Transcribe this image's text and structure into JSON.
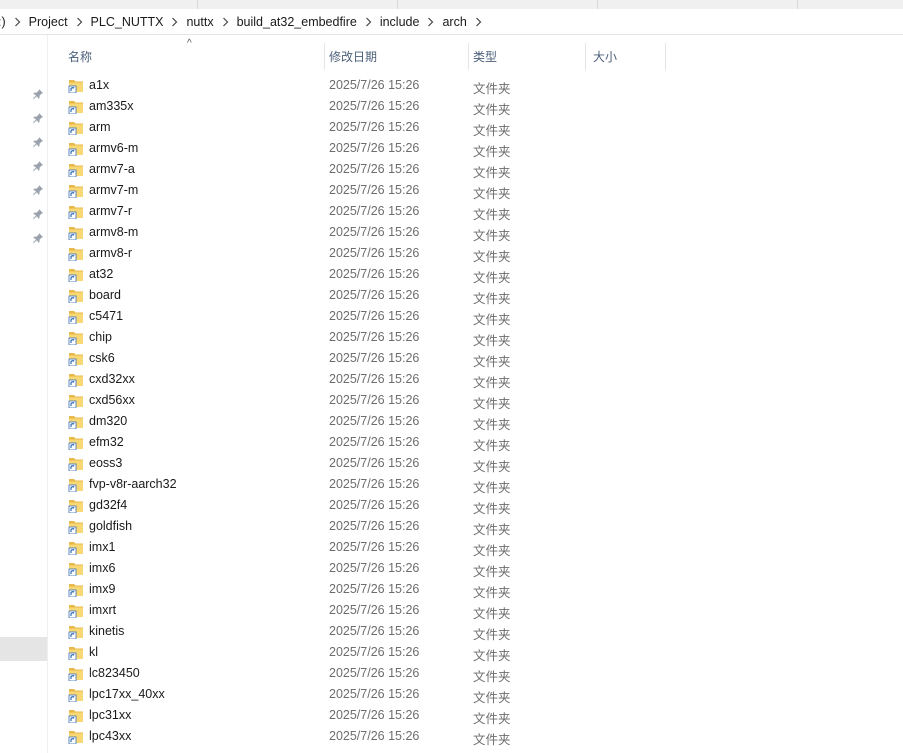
{
  "breadcrumb": {
    "items": [
      ":)",
      "Project",
      "PLC_NUTTX",
      "nuttx",
      "build_at32_embedfire",
      "include",
      "arch"
    ]
  },
  "columns": {
    "name": "名称",
    "date": "修改日期",
    "type": "类型",
    "size": "大小",
    "sort_indicator": "^"
  },
  "colors": {
    "folder_body": "#f8d775",
    "folder_back": "#e8b84a",
    "header_text": "#4c607a",
    "secondary_text": "#6d6d6d"
  },
  "icons": {
    "folder": "folder-shortcut-icon",
    "pin": "pin-icon",
    "chevron": "chevron-right-icon"
  },
  "files": [
    {
      "name": "a1x",
      "date": "2025/7/26 15:26",
      "type": "文件夹"
    },
    {
      "name": "am335x",
      "date": "2025/7/26 15:26",
      "type": "文件夹"
    },
    {
      "name": "arm",
      "date": "2025/7/26 15:26",
      "type": "文件夹"
    },
    {
      "name": "armv6-m",
      "date": "2025/7/26 15:26",
      "type": "文件夹"
    },
    {
      "name": "armv7-a",
      "date": "2025/7/26 15:26",
      "type": "文件夹"
    },
    {
      "name": "armv7-m",
      "date": "2025/7/26 15:26",
      "type": "文件夹"
    },
    {
      "name": "armv7-r",
      "date": "2025/7/26 15:26",
      "type": "文件夹"
    },
    {
      "name": "armv8-m",
      "date": "2025/7/26 15:26",
      "type": "文件夹"
    },
    {
      "name": "armv8-r",
      "date": "2025/7/26 15:26",
      "type": "文件夹"
    },
    {
      "name": "at32",
      "date": "2025/7/26 15:26",
      "type": "文件夹"
    },
    {
      "name": "board",
      "date": "2025/7/26 15:26",
      "type": "文件夹"
    },
    {
      "name": "c5471",
      "date": "2025/7/26 15:26",
      "type": "文件夹"
    },
    {
      "name": "chip",
      "date": "2025/7/26 15:26",
      "type": "文件夹"
    },
    {
      "name": "csk6",
      "date": "2025/7/26 15:26",
      "type": "文件夹"
    },
    {
      "name": "cxd32xx",
      "date": "2025/7/26 15:26",
      "type": "文件夹"
    },
    {
      "name": "cxd56xx",
      "date": "2025/7/26 15:26",
      "type": "文件夹"
    },
    {
      "name": "dm320",
      "date": "2025/7/26 15:26",
      "type": "文件夹"
    },
    {
      "name": "efm32",
      "date": "2025/7/26 15:26",
      "type": "文件夹"
    },
    {
      "name": "eoss3",
      "date": "2025/7/26 15:26",
      "type": "文件夹"
    },
    {
      "name": "fvp-v8r-aarch32",
      "date": "2025/7/26 15:26",
      "type": "文件夹"
    },
    {
      "name": "gd32f4",
      "date": "2025/7/26 15:26",
      "type": "文件夹"
    },
    {
      "name": "goldfish",
      "date": "2025/7/26 15:26",
      "type": "文件夹"
    },
    {
      "name": "imx1",
      "date": "2025/7/26 15:26",
      "type": "文件夹"
    },
    {
      "name": "imx6",
      "date": "2025/7/26 15:26",
      "type": "文件夹"
    },
    {
      "name": "imx9",
      "date": "2025/7/26 15:26",
      "type": "文件夹"
    },
    {
      "name": "imxrt",
      "date": "2025/7/26 15:26",
      "type": "文件夹"
    },
    {
      "name": "kinetis",
      "date": "2025/7/26 15:26",
      "type": "文件夹"
    },
    {
      "name": "kl",
      "date": "2025/7/26 15:26",
      "type": "文件夹"
    },
    {
      "name": "lc823450",
      "date": "2025/7/26 15:26",
      "type": "文件夹"
    },
    {
      "name": "lpc17xx_40xx",
      "date": "2025/7/26 15:26",
      "type": "文件夹"
    },
    {
      "name": "lpc31xx",
      "date": "2025/7/26 15:26",
      "type": "文件夹"
    },
    {
      "name": "lpc43xx",
      "date": "2025/7/26 15:26",
      "type": "文件夹"
    }
  ]
}
